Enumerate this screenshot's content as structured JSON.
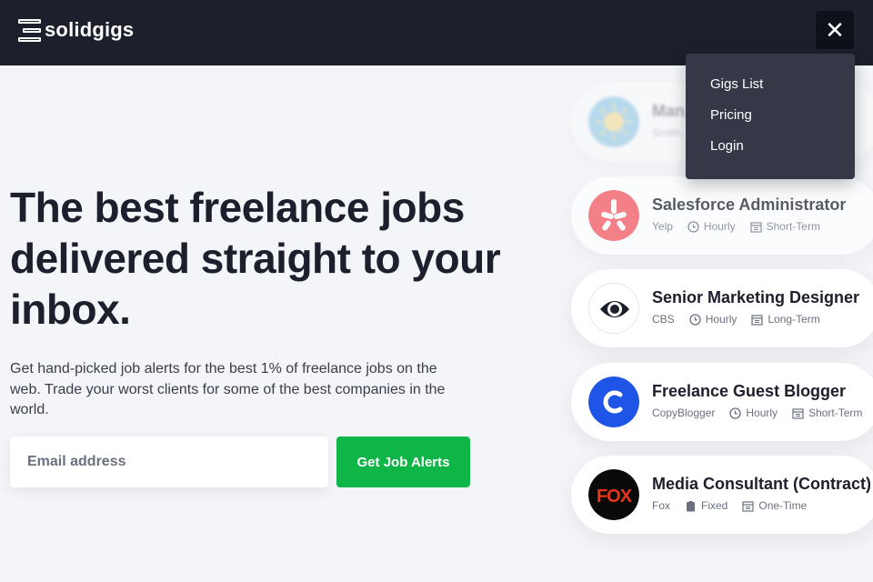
{
  "brand": {
    "name": "solidgigs"
  },
  "header": {
    "close_symbol": "✕"
  },
  "menu": {
    "items": [
      "Gigs List",
      "Pricing",
      "Login"
    ]
  },
  "hero": {
    "title": "The best freelance jobs delivered straight to your inbox.",
    "subtitle": "Get hand-picked job alerts for the best 1% of freelance jobs on the web. Trade your worst clients for some of the best companies in the world."
  },
  "signup": {
    "email_placeholder": "Email address",
    "button_label": "Get Job Alerts"
  },
  "jobs": [
    {
      "title": "Man…",
      "company": "Smith…",
      "rate": "",
      "term": "",
      "logo": "sun-logo"
    },
    {
      "title": "Salesforce Administrator",
      "company": "Yelp",
      "rate": "Hourly",
      "term": "Short-Term",
      "logo": "yelp-logo"
    },
    {
      "title": "Senior Marketing Designer",
      "company": "CBS",
      "rate": "Hourly",
      "term": "Long-Term",
      "logo": "cbs-logo"
    },
    {
      "title": "Freelance Guest Blogger",
      "company": "CopyBlogger",
      "rate": "Hourly",
      "term": "Short-Term",
      "logo": "copyblogger-logo"
    },
    {
      "title": "Media Consultant (Contract)",
      "company": "Fox",
      "rate": "Fixed",
      "term": "One-Time",
      "logo": "fox-logo"
    }
  ],
  "colors": {
    "header_bg": "#1d1f2c",
    "cta_green": "#10b547",
    "menu_bg": "#363847",
    "page_bg": "#f4f5f8"
  }
}
